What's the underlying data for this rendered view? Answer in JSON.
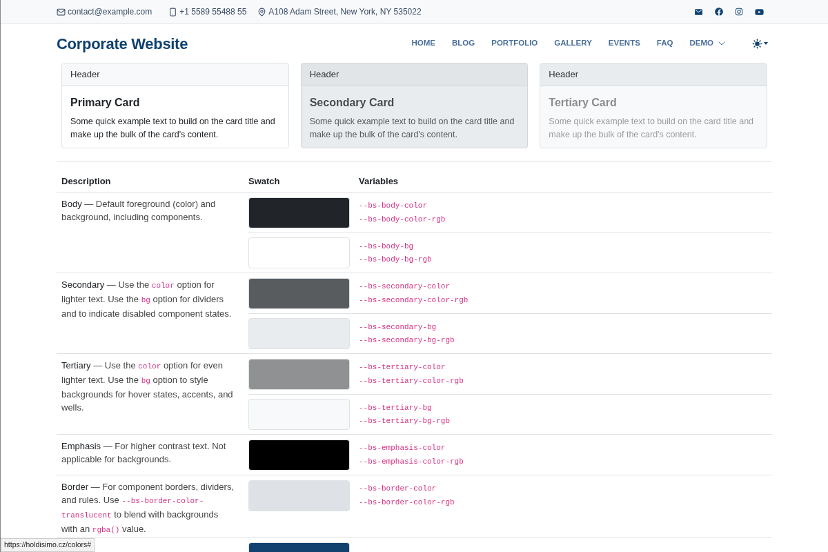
{
  "topbar": {
    "email": "contact@example.com",
    "phone": "+1 5589 55488 55",
    "address": "A108 Adam Street, New York, NY 535022"
  },
  "brand": "Corporate Website",
  "nav": [
    {
      "label": "HOME",
      "dropdown": false
    },
    {
      "label": "BLOG",
      "dropdown": false
    },
    {
      "label": "PORTFOLIO",
      "dropdown": false
    },
    {
      "label": "GALLERY",
      "dropdown": false
    },
    {
      "label": "EVENTS",
      "dropdown": false
    },
    {
      "label": "FAQ",
      "dropdown": false
    },
    {
      "label": "DEMO",
      "dropdown": true
    }
  ],
  "cards": [
    {
      "kind": "primary",
      "header": "Header",
      "title": "Primary Card",
      "text": "Some quick example text to build on the card title and make up the bulk of the card's content."
    },
    {
      "kind": "secondary",
      "header": "Header",
      "title": "Secondary Card",
      "text": "Some quick example text to build on the card title and make up the bulk of the card's content."
    },
    {
      "kind": "tertiary",
      "header": "Header",
      "title": "Tertiary Card",
      "text": "Some quick example text to build on the card title and make up the bulk of the card's content."
    }
  ],
  "table": {
    "columns": [
      "Description",
      "Swatch",
      "Variables"
    ],
    "rows": [
      {
        "description": [
          {
            "kind": "term",
            "text": "Body"
          },
          {
            "kind": "text",
            "text": " — Default foreground (color) and background, including components."
          }
        ],
        "swatches": [
          {
            "color": "#212529",
            "variables": [
              "--bs-body-color",
              "--bs-body-color-rgb"
            ]
          },
          {
            "color": "#ffffff",
            "variables": [
              "--bs-body-bg",
              "--bs-body-bg-rgb"
            ]
          }
        ]
      },
      {
        "description": [
          {
            "kind": "term",
            "text": "Secondary"
          },
          {
            "kind": "text",
            "text": " — Use the "
          },
          {
            "kind": "code",
            "text": "color"
          },
          {
            "kind": "text",
            "text": " option for lighter text. Use the "
          },
          {
            "kind": "code",
            "text": "bg"
          },
          {
            "kind": "text",
            "text": " option for dividers and to indicate disabled component states."
          }
        ],
        "swatches": [
          {
            "color": "#595c5f",
            "variables": [
              "--bs-secondary-color",
              "--bs-secondary-color-rgb"
            ]
          },
          {
            "color": "#e9ecef",
            "variables": [
              "--bs-secondary-bg",
              "--bs-secondary-bg-rgb"
            ]
          }
        ]
      },
      {
        "description": [
          {
            "kind": "term",
            "text": "Tertiary"
          },
          {
            "kind": "text",
            "text": " — Use the "
          },
          {
            "kind": "code",
            "text": "color"
          },
          {
            "kind": "text",
            "text": " option for even lighter text. Use the "
          },
          {
            "kind": "code",
            "text": "bg"
          },
          {
            "kind": "text",
            "text": " option to style backgrounds for hover states, accents, and wells."
          }
        ],
        "swatches": [
          {
            "color": "#909192",
            "variables": [
              "--bs-tertiary-color",
              "--bs-tertiary-color-rgb"
            ]
          },
          {
            "color": "#f8f9fa",
            "variables": [
              "--bs-tertiary-bg",
              "--bs-tertiary-bg-rgb"
            ]
          }
        ]
      },
      {
        "description": [
          {
            "kind": "term",
            "text": "Emphasis"
          },
          {
            "kind": "text",
            "text": " — For higher contrast text. Not applicable for backgrounds."
          }
        ],
        "swatches": [
          {
            "color": "#000000",
            "variables": [
              "--bs-emphasis-color",
              "--bs-emphasis-color-rgb"
            ]
          }
        ]
      },
      {
        "description": [
          {
            "kind": "term",
            "text": "Border"
          },
          {
            "kind": "text",
            "text": " — For component borders, dividers, and rules. Use "
          },
          {
            "kind": "code",
            "text": "--bs-border-color-translucent"
          },
          {
            "kind": "text",
            "text": " to blend with backgrounds with an "
          },
          {
            "kind": "code",
            "text": "rgba()"
          },
          {
            "kind": "text",
            "text": " value."
          }
        ],
        "swatches": [
          {
            "color": "#dee2e6",
            "variables": [
              "--bs-border-color",
              "--bs-border-color-rgb"
            ]
          }
        ]
      },
      {
        "description": [],
        "swatches": [
          {
            "color": "#10416f"
          }
        ]
      }
    ]
  },
  "theme_toggle": {
    "dark": false
  },
  "status_bar": "https://holdisimo.cz/colors#"
}
